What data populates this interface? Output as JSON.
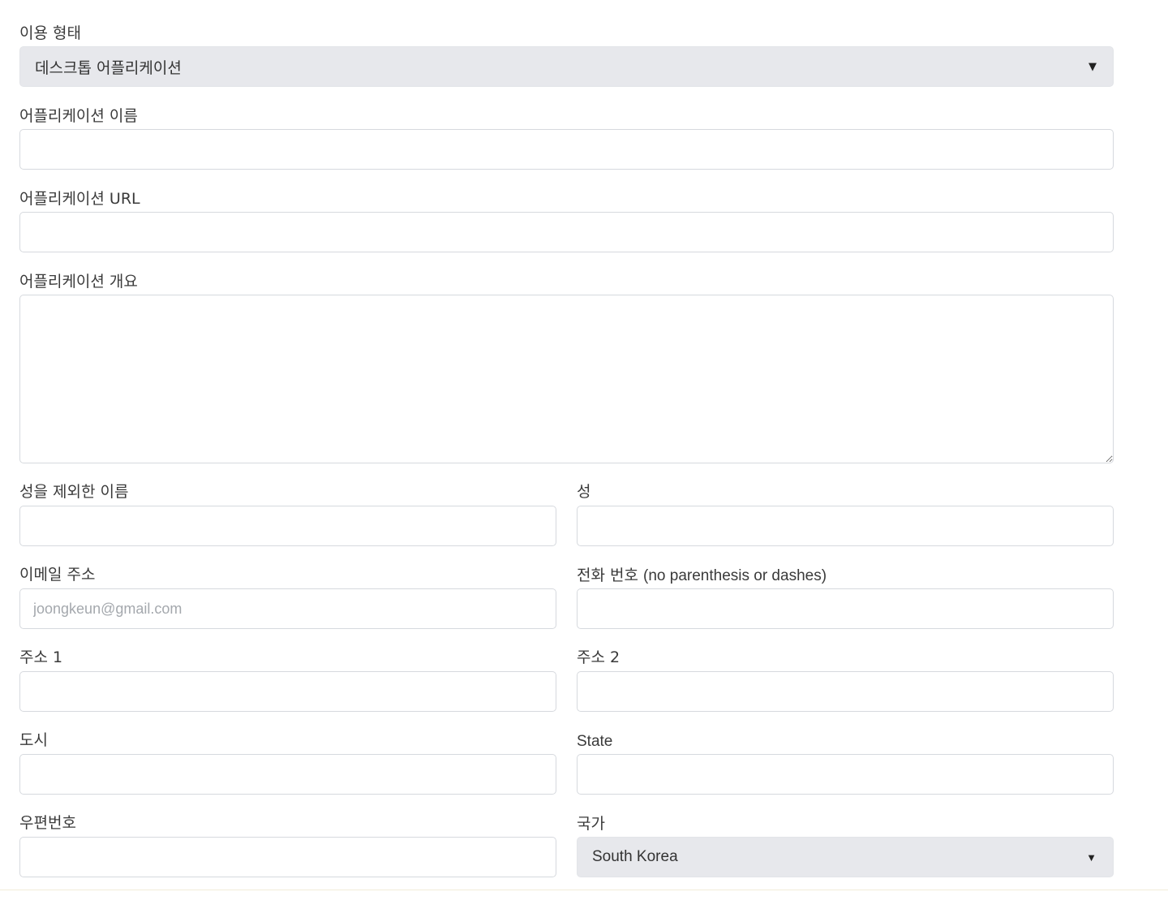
{
  "usage_type": {
    "label": "이용 형태",
    "selected": "데스크톱 어플리케이션"
  },
  "app_name": {
    "label": "어플리케이션 이름",
    "value": ""
  },
  "app_url": {
    "label": "어플리케이션 URL",
    "value": ""
  },
  "app_overview": {
    "label": "어플리케이션 개요",
    "value": ""
  },
  "first_name": {
    "label": "성을 제외한 이름",
    "value": ""
  },
  "last_name": {
    "label": "성",
    "value": ""
  },
  "email": {
    "label": "이메일 주소",
    "placeholder": "joongkeun@gmail.com"
  },
  "phone": {
    "label": "전화 번호",
    "label_note": "(no parenthesis or dashes)",
    "value": ""
  },
  "address1": {
    "label": "주소 1",
    "value": ""
  },
  "address2": {
    "label": "주소 2",
    "value": ""
  },
  "city": {
    "label": "도시",
    "value": ""
  },
  "state": {
    "label": "State",
    "value": ""
  },
  "postal_code": {
    "label": "우편번호",
    "value": ""
  },
  "country": {
    "label": "국가",
    "selected": "South Korea"
  },
  "icons": {
    "select_caret": "caret-down-icon"
  }
}
